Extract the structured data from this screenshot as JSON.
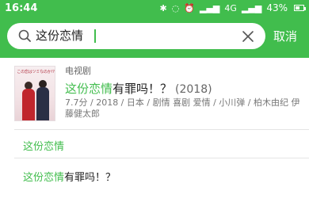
{
  "status_bar": {
    "time": "16:44",
    "signal_text": "4G",
    "battery": "43%"
  },
  "search": {
    "query": "这份恋情",
    "cancel_label": "取消"
  },
  "result": {
    "type_label": "电视剧",
    "title_highlight": "这份恋情",
    "title_rest": "有罪吗！？",
    "year": "(2018)",
    "meta": "7.7分 / 2018 / 日本 / 剧情 喜剧 爱情 / 小川弹 / 柏木由纪 伊藤健太郎",
    "poster_text": "この恋はツミなのか!?"
  },
  "suggestions": [
    {
      "highlight": "这份恋情",
      "rest": ""
    },
    {
      "highlight": "这份恋情",
      "rest": "有罪吗！？"
    }
  ],
  "colors": {
    "accent": "#41bd4d",
    "text": "#222222",
    "secondary_text": "#777777"
  }
}
